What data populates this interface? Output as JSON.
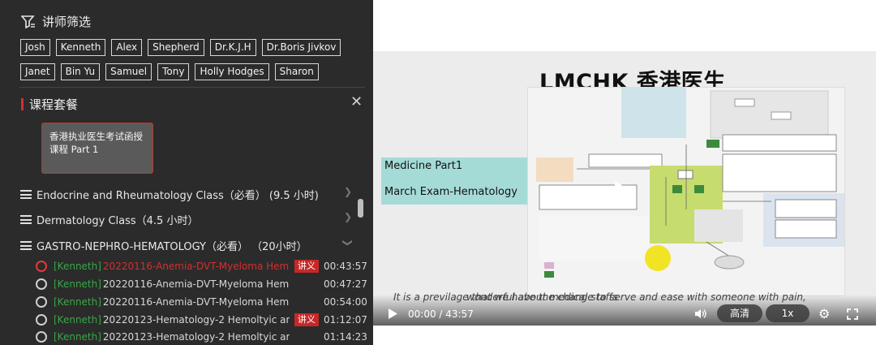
{
  "filter": {
    "title": "讲师筛选",
    "row1": [
      "Josh",
      "Kenneth",
      "Alex",
      "Shepherd",
      "Dr.K.J.H",
      "Dr.Boris Jivkov"
    ],
    "row2": [
      "Janet",
      "Bin Yu",
      "Samuel",
      "Tony",
      "Holly Hodges",
      "Sharon"
    ]
  },
  "section": {
    "title": "课程套餐",
    "close": "✕"
  },
  "package": {
    "title": "香港执业医生考试函授课程 Part 1"
  },
  "classes": [
    "Endocrine and Rheumatology Class（必看） (9.5 小时)",
    "Dermatology Class（4.5 小时）",
    "GASTRO-NEPHRO-HEMATOLOGY（必看） （20小时）"
  ],
  "lessons": [
    {
      "tag": "[Kenneth]",
      "title": "20220116-Anemia-DVT-Myeloma Hem...",
      "badge": "讲义",
      "time": "00:43:57"
    },
    {
      "tag": "[Kenneth]",
      "title": "20220116-Anemia-DVT-Myeloma Hem...",
      "badge": "",
      "time": "00:47:27"
    },
    {
      "tag": "[Kenneth]",
      "title": "20220116-Anemia-DVT-Myeloma Hem...",
      "badge": "",
      "time": "00:54:00"
    },
    {
      "tag": "[Kenneth]",
      "title": "20220123-Hematology-2 Hemoltyic an...",
      "badge": "讲义",
      "time": "01:12:07"
    },
    {
      "tag": "[Kenneth]",
      "title": "20220123-Hematology-2 Hemoltyic an...",
      "badge": "",
      "time": "01:14:23"
    }
  ],
  "video": {
    "slide_title": "LMCHK 香港医生",
    "slide_line1": "Medicine Part1",
    "slide_line2": "March Exam-Hematology",
    "subtitle": "It is a previlage that we have the change to serve and ease with someone with pain,",
    "subtitle2": "wonderful about medical staffs",
    "time": "00:00 / 43:57",
    "quality": "高清",
    "speed": "1x"
  },
  "colors": {
    "panel_bg": "#2b2b2b",
    "accent_red": "#c62828",
    "tag_green": "#3aa64a",
    "slide_teal": "#a5dbd7"
  }
}
